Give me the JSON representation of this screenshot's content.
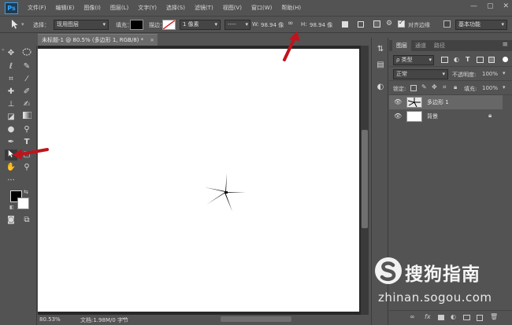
{
  "app": {
    "logo": "Ps"
  },
  "menu": [
    "文件(F)",
    "编辑(E)",
    "图像(I)",
    "图层(L)",
    "文字(Y)",
    "选择(S)",
    "滤镜(T)",
    "视图(V)",
    "窗口(W)",
    "帮助(H)"
  ],
  "options": {
    "select_label": "选择：",
    "select_value": "现用图层",
    "fill_label": "填充：",
    "stroke_label": "描边：",
    "stroke_width": "1 像素",
    "w_label": "W:",
    "w_value": "98.94 像",
    "h_label": "H:",
    "h_value": "98.94 像",
    "align_edges": "对齐边缘",
    "workspace": "基本功能"
  },
  "document": {
    "tab_title": "未标题-1 @ 80.5% (多边形 1, RGB/8) *",
    "close": "×",
    "zoom": "80.53%",
    "doc_info": "文档:1.98M/0 字节"
  },
  "layers_panel": {
    "tabs": [
      "图层",
      "通道",
      "路径"
    ],
    "filter": "ρ 类型",
    "blend_mode": "正常",
    "opacity_label": "不透明度:",
    "opacity_value": "100%",
    "lock_label": "锁定:",
    "fill_label": "填充:",
    "fill_value": "100%",
    "layers": [
      {
        "name": "多边形 1",
        "selected": true
      },
      {
        "name": "背景",
        "selected": false
      }
    ],
    "bottom_icons": [
      "link-icon",
      "fx-icon",
      "mask-icon",
      "adjustment-icon",
      "folder-icon",
      "new-layer-icon",
      "trash-icon"
    ],
    "bottom_fx": "fx"
  },
  "watermark": {
    "title": "搜狗指南",
    "url": "zhinan.sogou.com"
  },
  "colors": {
    "arrow": "#c0141c",
    "panel_bg": "#535353",
    "canvas_bg": "#282828"
  }
}
